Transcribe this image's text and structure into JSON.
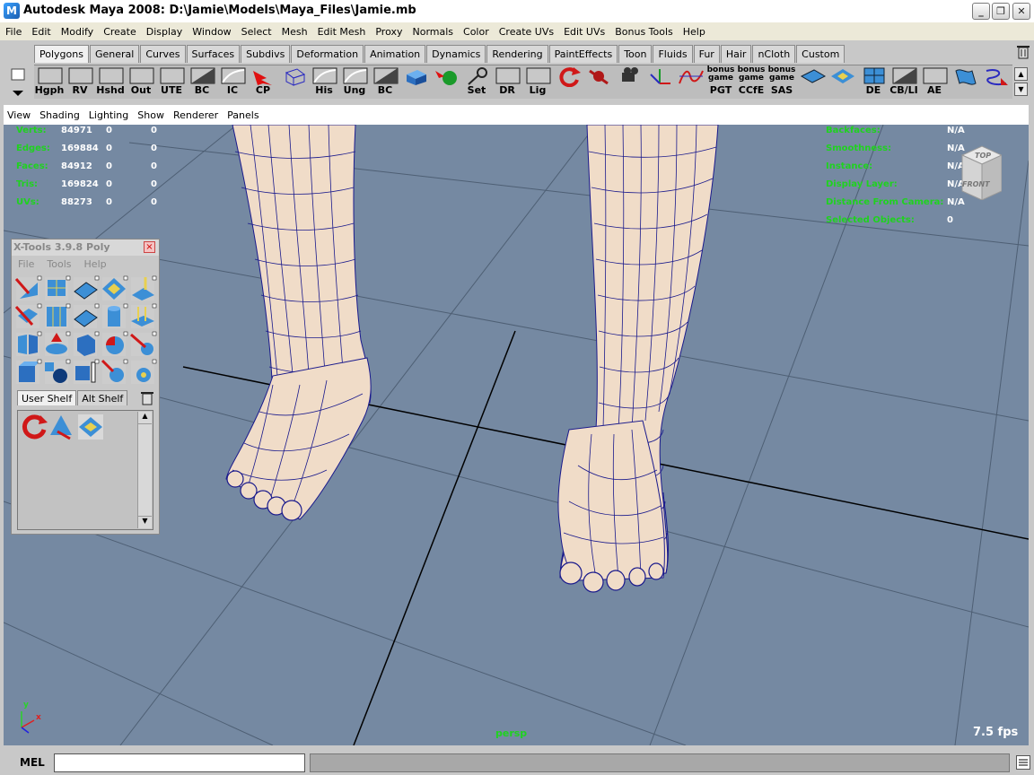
{
  "window": {
    "title": "Autodesk Maya 2008: D:\\Jamie\\Models\\Maya_Files\\Jamie.mb",
    "app_icon": "M"
  },
  "menubar": [
    "File",
    "Edit",
    "Modify",
    "Create",
    "Display",
    "Window",
    "Select",
    "Mesh",
    "Edit Mesh",
    "Proxy",
    "Normals",
    "Color",
    "Create UVs",
    "Edit UVs",
    "Bonus Tools",
    "Help"
  ],
  "shelf_tabs": [
    "Polygons",
    "General",
    "Curves",
    "Surfaces",
    "Subdivs",
    "Deformation",
    "Animation",
    "Dynamics",
    "Rendering",
    "PaintEffects",
    "Toon",
    "Fluids",
    "Fur",
    "Hair",
    "nCloth",
    "Custom"
  ],
  "shelf_active_tab": "Polygons",
  "shelf_buttons": [
    {
      "label": "Hgph",
      "icon": "box"
    },
    {
      "label": "RV",
      "icon": "box"
    },
    {
      "label": "Hshd",
      "icon": "box"
    },
    {
      "label": "Out",
      "icon": "box"
    },
    {
      "label": "UTE",
      "icon": "box"
    },
    {
      "label": "BC",
      "icon": "dark-box"
    },
    {
      "label": "IC",
      "icon": "curve"
    },
    {
      "label": "CP",
      "icon": "red-arrow"
    },
    {
      "label": "",
      "icon": "wire-cube"
    },
    {
      "label": "His",
      "icon": "curve"
    },
    {
      "label": "Ung",
      "icon": "curve"
    },
    {
      "label": "BC",
      "icon": "dark-box"
    },
    {
      "label": "",
      "icon": "blue-cube"
    },
    {
      "label": "",
      "icon": "sphere-arrow"
    },
    {
      "label": "Set",
      "icon": "key"
    },
    {
      "label": "DR",
      "icon": "box"
    },
    {
      "label": "Lig",
      "icon": "box"
    },
    {
      "label": "",
      "icon": "red-rotate"
    },
    {
      "label": "",
      "icon": "red-joint"
    },
    {
      "label": "",
      "icon": "camera"
    },
    {
      "label": "",
      "icon": "nv-arrows"
    },
    {
      "label": "",
      "icon": "graph"
    },
    {
      "label": "PGT",
      "icon": "bonus",
      "top": "bonus game"
    },
    {
      "label": "CCfE",
      "icon": "bonus",
      "top": "bonus game"
    },
    {
      "label": "SAS",
      "icon": "bonus",
      "top": "bonus game"
    },
    {
      "label": "",
      "icon": "blue-plane"
    },
    {
      "label": "",
      "icon": "uv-grid"
    },
    {
      "label": "DE",
      "icon": "blue-grid"
    },
    {
      "label": "CB/LI",
      "icon": "dark-box"
    },
    {
      "label": "AE",
      "icon": "box"
    },
    {
      "label": "",
      "icon": "blue-cloth"
    },
    {
      "label": "",
      "icon": "select-curve"
    }
  ],
  "panel_menu": [
    "View",
    "Shading",
    "Lighting",
    "Show",
    "Renderer",
    "Panels"
  ],
  "hud_left": {
    "labels": [
      "Verts:",
      "Edges:",
      "Faces:",
      "Tris:",
      "UVs:"
    ],
    "values": [
      [
        "84971",
        "0",
        "0"
      ],
      [
        "169884",
        "0",
        "0"
      ],
      [
        "84912",
        "0",
        "0"
      ],
      [
        "169824",
        "0",
        "0"
      ],
      [
        "88273",
        "0",
        "0"
      ]
    ]
  },
  "hud_right": {
    "labels": [
      "Backfaces:",
      "Smoothness:",
      "Instance:",
      "Display Layer:",
      "Distance From Camera:",
      "Selected Objects:"
    ],
    "values": [
      "N/A",
      "N/A",
      "N/A",
      "N/A",
      "N/A",
      "0"
    ]
  },
  "viewcube": {
    "top": "TOP",
    "front": "FRONT"
  },
  "camera_name": "persp",
  "fps": "7.5 fps",
  "axis": {
    "x": "x",
    "y": "y"
  },
  "xtools": {
    "title": "X-Tools 3.9.8 Poly",
    "menu": [
      "File",
      "Tools",
      "Help"
    ],
    "tabs": [
      "User Shelf",
      "Alt Shelf"
    ],
    "close": "×"
  },
  "cmdline": {
    "label": "MEL",
    "input_value": "",
    "output": ""
  },
  "colors": {
    "viewport_bg": "#7589a2",
    "mesh_fill": "#f0dcc8",
    "wire": "#1a1a8c",
    "hud_label": "#1fd21f",
    "hud_value": "#ffffff"
  }
}
